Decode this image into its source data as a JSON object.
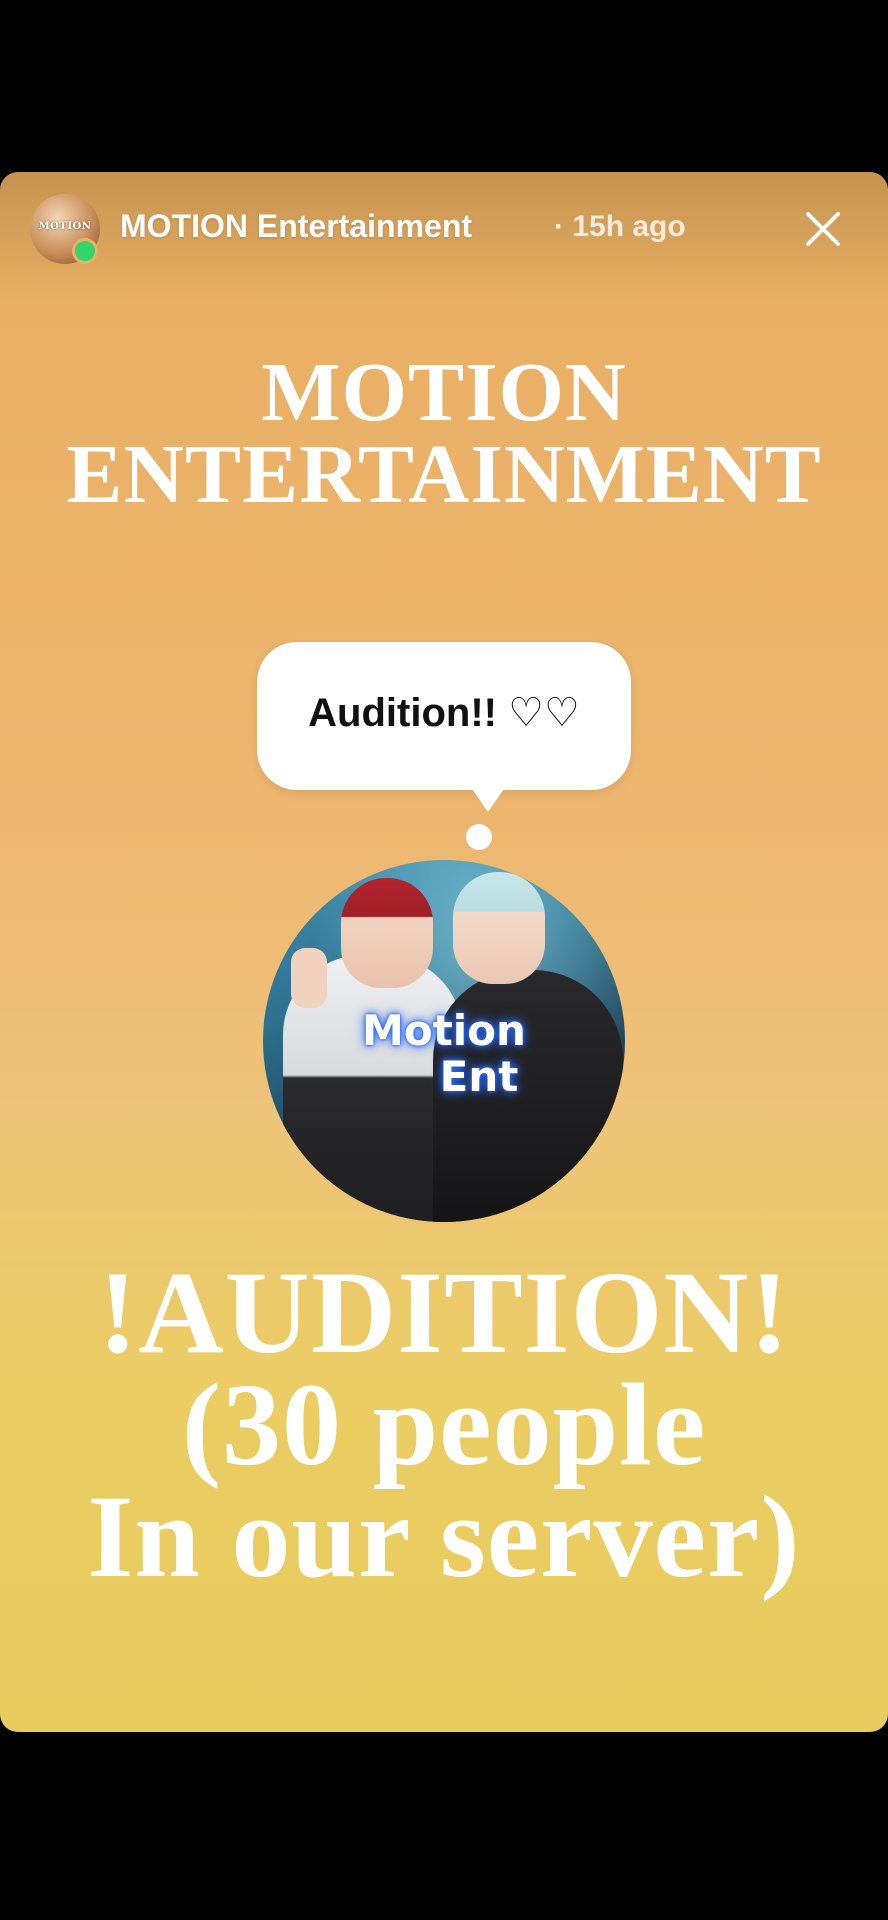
{
  "story": {
    "account_name": "MOTION Entertainment",
    "time_ago": "· 15h ago",
    "avatar_text": "MOTION",
    "close_icon": "close-icon",
    "title_lines": [
      "MOTION",
      "ENTERTAINMENT"
    ],
    "bubble_text": "Audition!! ♡♡",
    "photo_label_lines": [
      "Motion",
      "Ent"
    ],
    "audition_lines": [
      "!AUDITION!",
      "(30 people",
      "In our server)"
    ],
    "colors": {
      "gradient_top": "#e3ad62",
      "gradient_bottom": "#e8cc5e",
      "online_dot": "#33d46a",
      "label_glow": "#2a6cff"
    }
  }
}
